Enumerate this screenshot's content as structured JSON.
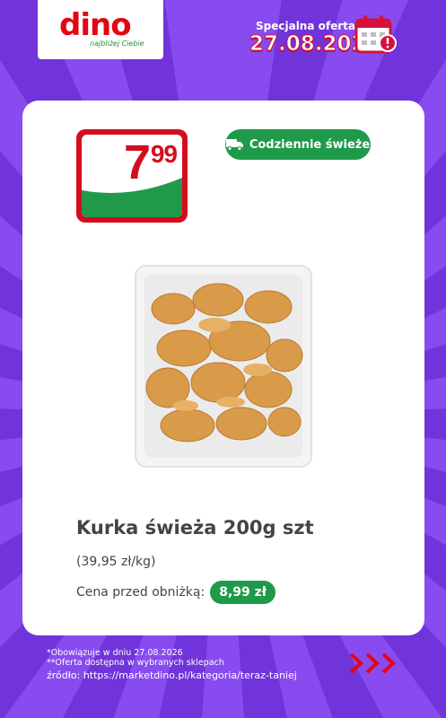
{
  "header": {
    "logo_text": "dino",
    "logo_tagline": "najbliżej Ciebie",
    "offer_label": "Specjalna oferta",
    "offer_date": "27.08.2026",
    "calendar_icon": "calendar-alert-icon"
  },
  "product": {
    "price_main": "7",
    "price_cents": "99",
    "fresh_label": "Codziennie świeże",
    "fresh_icon": "truck-icon",
    "title": "Kurka świeża 200g szt",
    "unit_price": "(39,95 zł/kg)",
    "before_label": "Cena przed obniżką:",
    "before_price": "8,99 zł"
  },
  "footer": {
    "note1": "*Obowiązuje w dniu 27.08.2026",
    "note2": "**Oferta dostępna w wybranych sklepach",
    "source": "źródło: https://marketdino.pl/kategoria/teraz-taniej",
    "arrows_icon": "triple-chevron-right-icon"
  },
  "colors": {
    "background": "#7b3fe4",
    "brand_red": "#d40d1d",
    "brand_green": "#1f9a4a"
  }
}
